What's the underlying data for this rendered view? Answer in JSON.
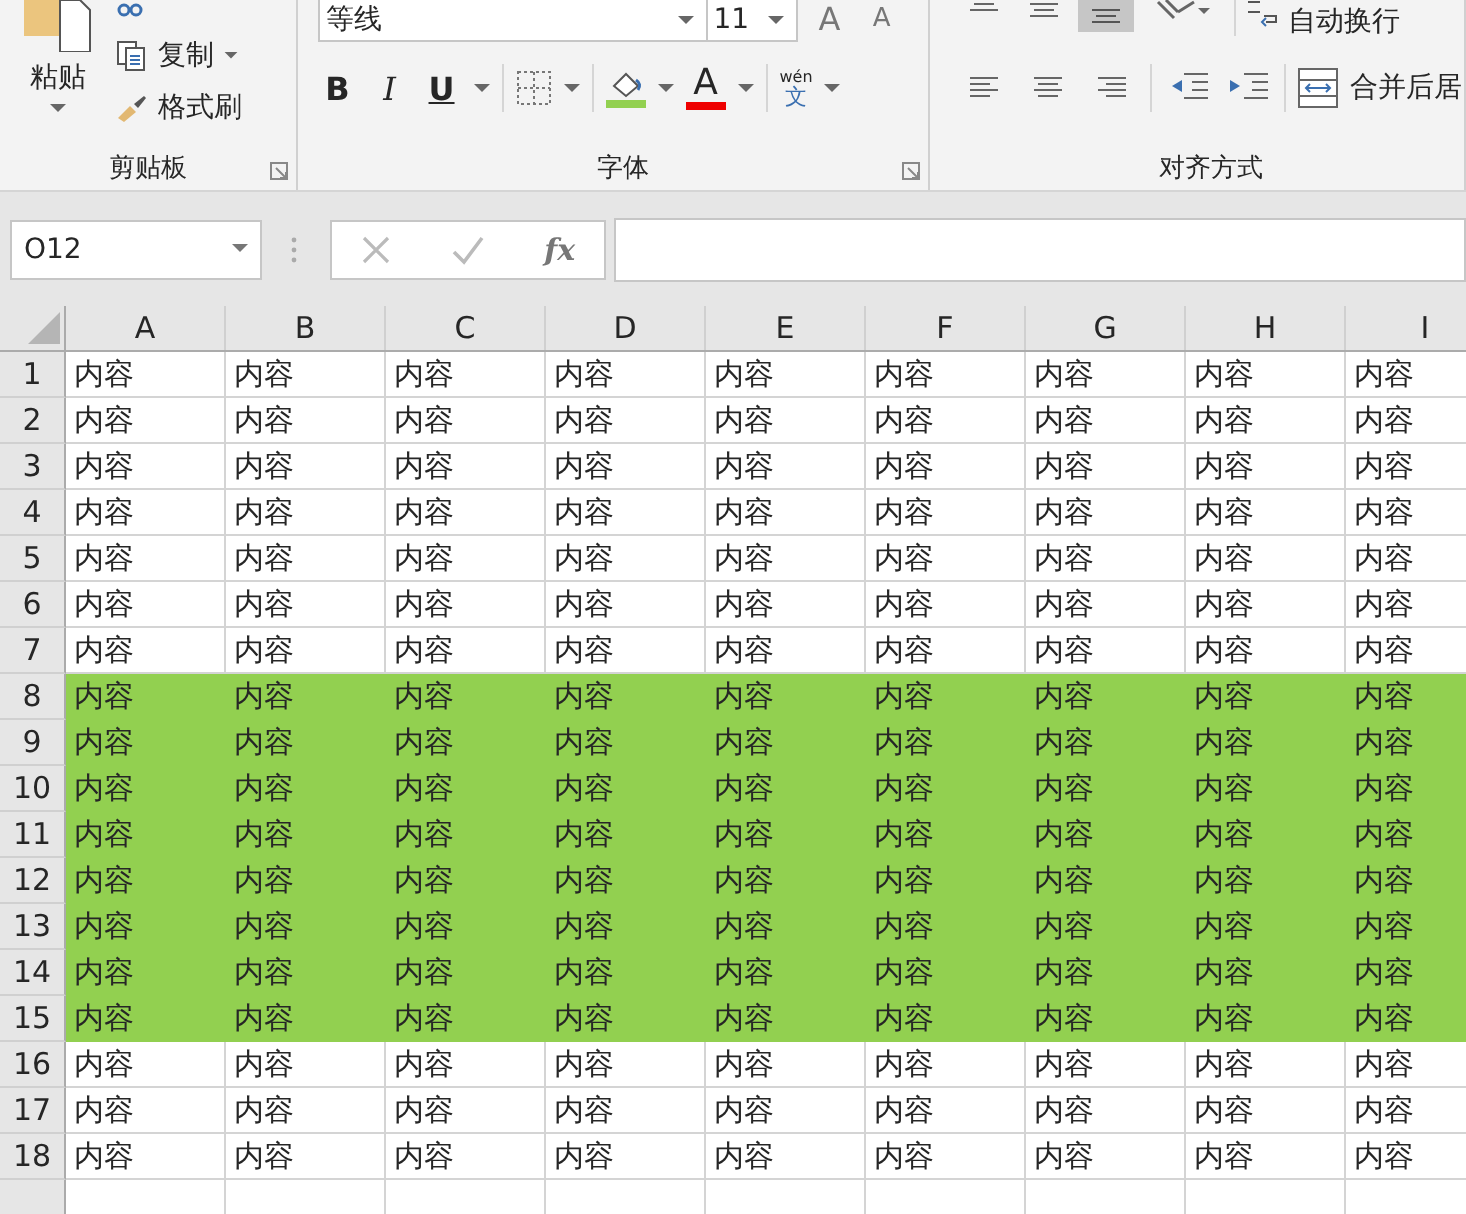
{
  "ribbon": {
    "clipboard": {
      "paste": "粘贴",
      "copy": "复制",
      "format_painter": "格式刷",
      "label": "剪贴板"
    },
    "font": {
      "font_name": "等线",
      "font_size": "11",
      "grow": "A",
      "shrink": "A",
      "bold": "B",
      "italic": "I",
      "underline": "U",
      "font_color": "A",
      "phonetic_top": "wén",
      "phonetic_bottom": "文",
      "label": "字体"
    },
    "alignment": {
      "wrap_text": "自动换行",
      "merge_center": "合并后居",
      "label": "对齐方式"
    }
  },
  "formula_bar": {
    "name_box": "O12",
    "fx": "fx"
  },
  "columns": [
    "A",
    "B",
    "C",
    "D",
    "E",
    "F",
    "G",
    "H",
    "I"
  ],
  "rows": [
    {
      "header": "1",
      "highlighted": false,
      "cells": [
        "内容",
        "内容",
        "内容",
        "内容",
        "内容",
        "内容",
        "内容",
        "内容",
        "内容"
      ]
    },
    {
      "header": "2",
      "highlighted": false,
      "cells": [
        "内容",
        "内容",
        "内容",
        "内容",
        "内容",
        "内容",
        "内容",
        "内容",
        "内容"
      ]
    },
    {
      "header": "3",
      "highlighted": false,
      "cells": [
        "内容",
        "内容",
        "内容",
        "内容",
        "内容",
        "内容",
        "内容",
        "内容",
        "内容"
      ]
    },
    {
      "header": "4",
      "highlighted": false,
      "cells": [
        "内容",
        "内容",
        "内容",
        "内容",
        "内容",
        "内容",
        "内容",
        "内容",
        "内容"
      ]
    },
    {
      "header": "5",
      "highlighted": false,
      "cells": [
        "内容",
        "内容",
        "内容",
        "内容",
        "内容",
        "内容",
        "内容",
        "内容",
        "内容"
      ]
    },
    {
      "header": "6",
      "highlighted": false,
      "cells": [
        "内容",
        "内容",
        "内容",
        "内容",
        "内容",
        "内容",
        "内容",
        "内容",
        "内容"
      ]
    },
    {
      "header": "7",
      "highlighted": false,
      "cells": [
        "内容",
        "内容",
        "内容",
        "内容",
        "内容",
        "内容",
        "内容",
        "内容",
        "内容"
      ]
    },
    {
      "header": "8",
      "highlighted": true,
      "cells": [
        "内容",
        "内容",
        "内容",
        "内容",
        "内容",
        "内容",
        "内容",
        "内容",
        "内容"
      ]
    },
    {
      "header": "9",
      "highlighted": true,
      "cells": [
        "内容",
        "内容",
        "内容",
        "内容",
        "内容",
        "内容",
        "内容",
        "内容",
        "内容"
      ]
    },
    {
      "header": "10",
      "highlighted": true,
      "cells": [
        "内容",
        "内容",
        "内容",
        "内容",
        "内容",
        "内容",
        "内容",
        "内容",
        "内容"
      ]
    },
    {
      "header": "11",
      "highlighted": true,
      "cells": [
        "内容",
        "内容",
        "内容",
        "内容",
        "内容",
        "内容",
        "内容",
        "内容",
        "内容"
      ]
    },
    {
      "header": "12",
      "highlighted": true,
      "cells": [
        "内容",
        "内容",
        "内容",
        "内容",
        "内容",
        "内容",
        "内容",
        "内容",
        "内容"
      ]
    },
    {
      "header": "13",
      "highlighted": true,
      "cells": [
        "内容",
        "内容",
        "内容",
        "内容",
        "内容",
        "内容",
        "内容",
        "内容",
        "内容"
      ]
    },
    {
      "header": "14",
      "highlighted": true,
      "cells": [
        "内容",
        "内容",
        "内容",
        "内容",
        "内容",
        "内容",
        "内容",
        "内容",
        "内容"
      ]
    },
    {
      "header": "15",
      "highlighted": true,
      "cells": [
        "内容",
        "内容",
        "内容",
        "内容",
        "内容",
        "内容",
        "内容",
        "内容",
        "内容"
      ]
    },
    {
      "header": "16",
      "highlighted": false,
      "cells": [
        "内容",
        "内容",
        "内容",
        "内容",
        "内容",
        "内容",
        "内容",
        "内容",
        "内容"
      ]
    },
    {
      "header": "17",
      "highlighted": false,
      "cells": [
        "内容",
        "内容",
        "内容",
        "内容",
        "内容",
        "内容",
        "内容",
        "内容",
        "内容"
      ]
    },
    {
      "header": "18",
      "highlighted": false,
      "cells": [
        "内容",
        "内容",
        "内容",
        "内容",
        "内容",
        "内容",
        "内容",
        "内容",
        "内容"
      ]
    }
  ]
}
